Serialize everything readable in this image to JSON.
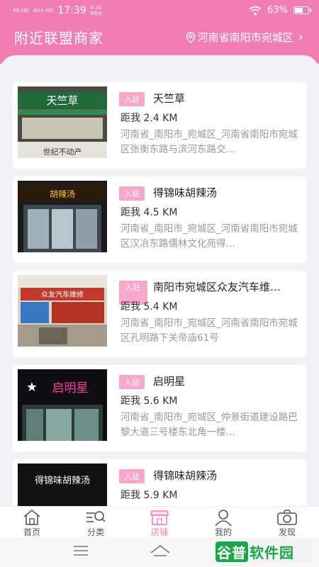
{
  "status": {
    "signal1": "4G HD",
    "signal2": "4G+ HD",
    "time": "17:39",
    "speed_value": "0.10",
    "speed_unit": "KB/s",
    "battery": "63%",
    "battery_level": 0.63
  },
  "header": {
    "title": "附近联盟商家",
    "location": "河南省南阳市宛城区"
  },
  "tag_label": "入驻",
  "merchants": [
    {
      "name": "天竺草",
      "distance": "距我 2.4 KM",
      "address": "河南省_南阳市_宛城区_河南省南阳市宛城区张衡东路与滨河东路交…",
      "sign": "天竺草",
      "sub_sign": "世纪不动产"
    },
    {
      "name": "得锦味胡辣汤",
      "distance": "距我 4.5 KM",
      "address": "河南省_南阳市_宛城区_河南省南阳市宛城区汉冶东路儒林文化苑得…",
      "sign": "胡辣汤"
    },
    {
      "name": "南阳市宛城区众友汽车维…",
      "distance": "距我 5.4 KM",
      "address": "河南省_南阳市_宛城区_河南省南阳市宛城区孔明路下关帝庙61号",
      "sign": "众友汽车维修"
    },
    {
      "name": "启明星",
      "distance": "距我 5.6 KM",
      "address": "河南省_南阳市_宛城区_仲景街道建设路巴黎大道三号楼东北角一楼…",
      "sign": "启明星"
    },
    {
      "name": "得锦味胡辣汤",
      "distance": "距我 5.9 KM",
      "address": "",
      "sign": "得锦味胡辣汤"
    }
  ],
  "tabs": [
    "首页",
    "分类",
    "店铺",
    "我的",
    "发现"
  ],
  "watermark": {
    "a": "谷普",
    "b": "软件园"
  },
  "colors": {
    "brand": "#f07eb2",
    "tag": "#f8a6c9"
  }
}
